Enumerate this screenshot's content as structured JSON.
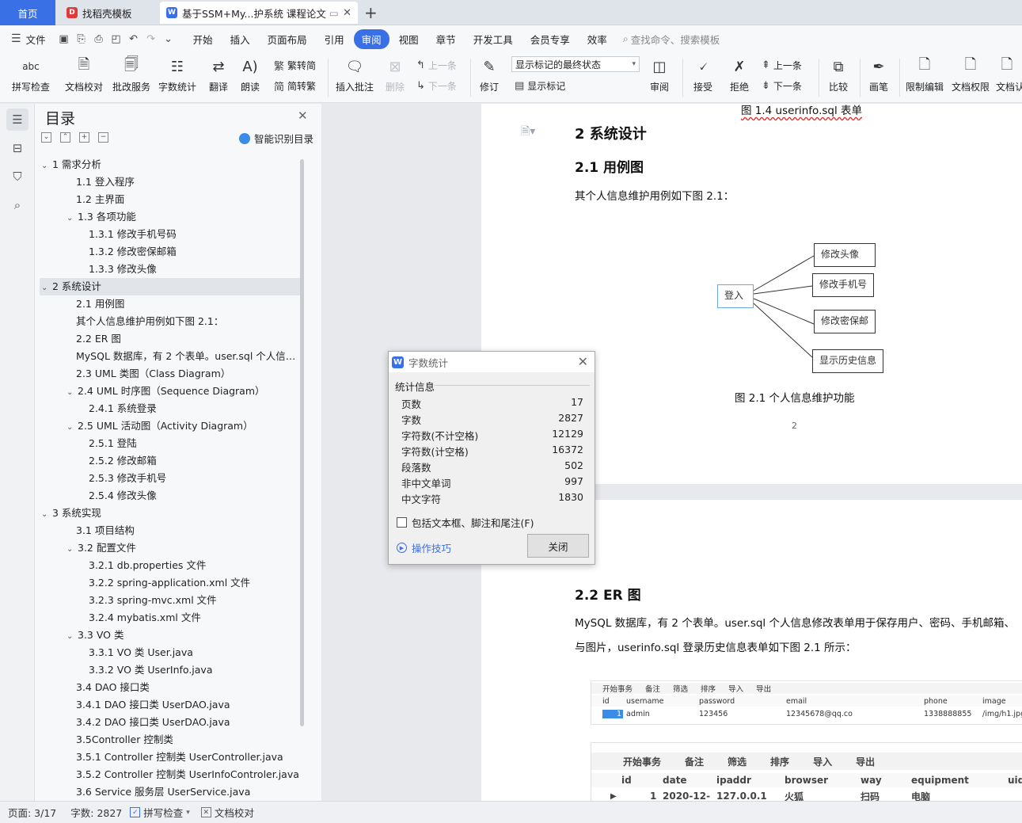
{
  "tabs": {
    "home": "首页",
    "template": "找稻壳模板",
    "document": "基于SSM+My...护系统 课程论文"
  },
  "menu": {
    "file": "文件",
    "items": [
      "开始",
      "插入",
      "页面布局",
      "引用",
      "审阅",
      "视图",
      "章节",
      "开发工具",
      "会员专享",
      "效率"
    ],
    "active": "审阅",
    "search": "查找命令、搜索模板"
  },
  "ribbon": {
    "spell": "拼写检查",
    "proof": "文档校对",
    "batch": "批改服务",
    "wordcount": "字数统计",
    "translate": "翻译",
    "read": "朗读",
    "to_trad": "繁转简",
    "to_simp": "简转繁",
    "insert_comment": "插入批注",
    "delete": "删除",
    "prev": "上一条",
    "next": "下一条",
    "revise": "修订",
    "markup_state": "显示标记的最终状态",
    "show_markup": "显示标记",
    "review": "审阅",
    "accept": "接受",
    "reject": "拒绝",
    "prev2": "上一条",
    "next2": "下一条",
    "compare": "比较",
    "pen": "画笔",
    "restrict": "限制编辑",
    "rights": "文档权限",
    "doc_more": "文档认"
  },
  "toc": {
    "title": "目录",
    "smart": "智能识别目录",
    "items": [
      {
        "t": "1  需求分析",
        "lvl": 1,
        "car": "v"
      },
      {
        "t": "1.1 登入程序",
        "lvl": 2
      },
      {
        "t": "1.2 主界面",
        "lvl": 2
      },
      {
        "t": "1.3 各项功能",
        "lvl": 2,
        "car": "v"
      },
      {
        "t": "1.3.1  修改手机号码",
        "lvl": 3
      },
      {
        "t": "1.3.2  修改密保邮箱",
        "lvl": 3
      },
      {
        "t": "1.3.3  修改头像",
        "lvl": 3
      },
      {
        "t": "2  系统设计",
        "lvl": 1,
        "car": "v",
        "sel": true
      },
      {
        "t": "2.1 用例图",
        "lvl": 2
      },
      {
        "t": "其个人信息维护用例如下图 2.1：",
        "lvl": 2
      },
      {
        "t": "2.2 ER 图",
        "lvl": 2
      },
      {
        "t": "MySQL 数据库，有 2 个表单。user.sql 个人信息 ...",
        "lvl": 2
      },
      {
        "t": "2.3 UML 类图（Class Diagram）",
        "lvl": 2
      },
      {
        "t": "2.4 UML 时序图（Sequence Diagram）",
        "lvl": 2,
        "car": "v"
      },
      {
        "t": "2.4.1  系统登录",
        "lvl": 3
      },
      {
        "t": "2.5 UML 活动图（Activity Diagram）",
        "lvl": 2,
        "car": "v"
      },
      {
        "t": "2.5.1  登陆",
        "lvl": 3
      },
      {
        "t": "2.5.2  修改邮箱",
        "lvl": 3
      },
      {
        "t": "2.5.3  修改手机号",
        "lvl": 3
      },
      {
        "t": "2.5.4  修改头像",
        "lvl": 3
      },
      {
        "t": "3  系统实现",
        "lvl": 1,
        "car": "v"
      },
      {
        "t": "3.1  项目结构",
        "lvl": 2
      },
      {
        "t": "3.2  配置文件",
        "lvl": 2,
        "car": "v"
      },
      {
        "t": "3.2.1 db.properties 文件",
        "lvl": 3
      },
      {
        "t": "3.2.2 spring-application.xml 文件",
        "lvl": 3
      },
      {
        "t": "3.2.3 spring-mvc.xml 文件",
        "lvl": 3
      },
      {
        "t": "3.2.4 mybatis.xml 文件",
        "lvl": 3
      },
      {
        "t": "3.3 VO 类",
        "lvl": 2,
        "car": "v"
      },
      {
        "t": "3.3.1    VO 类 User.java",
        "lvl": 3
      },
      {
        "t": "3.3.2    VO 类 UserInfo.java",
        "lvl": 3
      },
      {
        "t": "3.4 DAO 接口类",
        "lvl": 2
      },
      {
        "t": "3.4.1 DAO 接口类 UserDAO.java",
        "lvl": 2
      },
      {
        "t": "3.4.2 DAO 接口类 UserDAO.java",
        "lvl": 2
      },
      {
        "t": "3.5Controller 控制类",
        "lvl": 2
      },
      {
        "t": "3.5.1 Controller 控制类 UserController.java",
        "lvl": 2
      },
      {
        "t": "3.5.2 Controller 控制类 UserInfoControler.java",
        "lvl": 2
      },
      {
        "t": "3.6 Service 服务层 UserService.java",
        "lvl": 2
      }
    ]
  },
  "doc": {
    "prev_caption": "图 1.4 userinfo.sql 表单",
    "h_chapter": "2  系统设计",
    "h_usecase": "2.1 用例图",
    "p_usecase": "其个人信息维护用例如下图 2.1：",
    "actor": "登入",
    "uc": [
      "修改头像",
      "修改手机号",
      "修改密保邮",
      "显示历史信息"
    ],
    "fig_caption": "图 2.1 个人信息维护功能",
    "page_num": "2",
    "h_er": "2.2 ER 图",
    "p_er1": "MySQL 数据库，有 2 个表单。user.sql 个人信息修改表单用于保存用户、密码、手机邮箱、",
    "p_er2": "与图片，userinfo.sql 登录历史信息表单如下图 2.1 所示：",
    "shot1": {
      "toolbar": [
        "开始事务",
        "备注",
        "筛选",
        "排序",
        "导入",
        "导出"
      ],
      "headers": [
        "id",
        "username",
        "password",
        "email",
        "phone",
        "image"
      ],
      "row": [
        "1",
        "admin",
        "123456",
        "12345678@qq.co",
        "1338888855",
        "/img/h1.jpg"
      ]
    },
    "shot2": {
      "toolbar": [
        "开始事务",
        "备注",
        "筛选",
        "排序",
        "导入",
        "导出"
      ],
      "headers": [
        "id",
        "date",
        "ipaddr",
        "browser",
        "way",
        "equipment",
        "uid"
      ],
      "row": [
        "1",
        "2020-12-",
        "127.0.0.1",
        "火狐",
        "扫码",
        "电脑",
        ""
      ]
    }
  },
  "dialog": {
    "title": "字数统计",
    "group": "统计信息",
    "stats": [
      {
        "label": "页数",
        "value": "17"
      },
      {
        "label": "字数",
        "value": "2827"
      },
      {
        "label": "字符数(不计空格)",
        "value": "12129"
      },
      {
        "label": "字符数(计空格)",
        "value": "16372"
      },
      {
        "label": "段落数",
        "value": "502"
      },
      {
        "label": "非中文单词",
        "value": "997"
      },
      {
        "label": "中文字符",
        "value": "1830"
      }
    ],
    "checkbox": "包括文本框、脚注和尾注(F)",
    "tips": "操作技巧",
    "close": "关闭"
  },
  "status": {
    "page": "页面: 3/17",
    "words": "字数: 2827",
    "spell": "拼写检查",
    "proof": "文档校对"
  }
}
